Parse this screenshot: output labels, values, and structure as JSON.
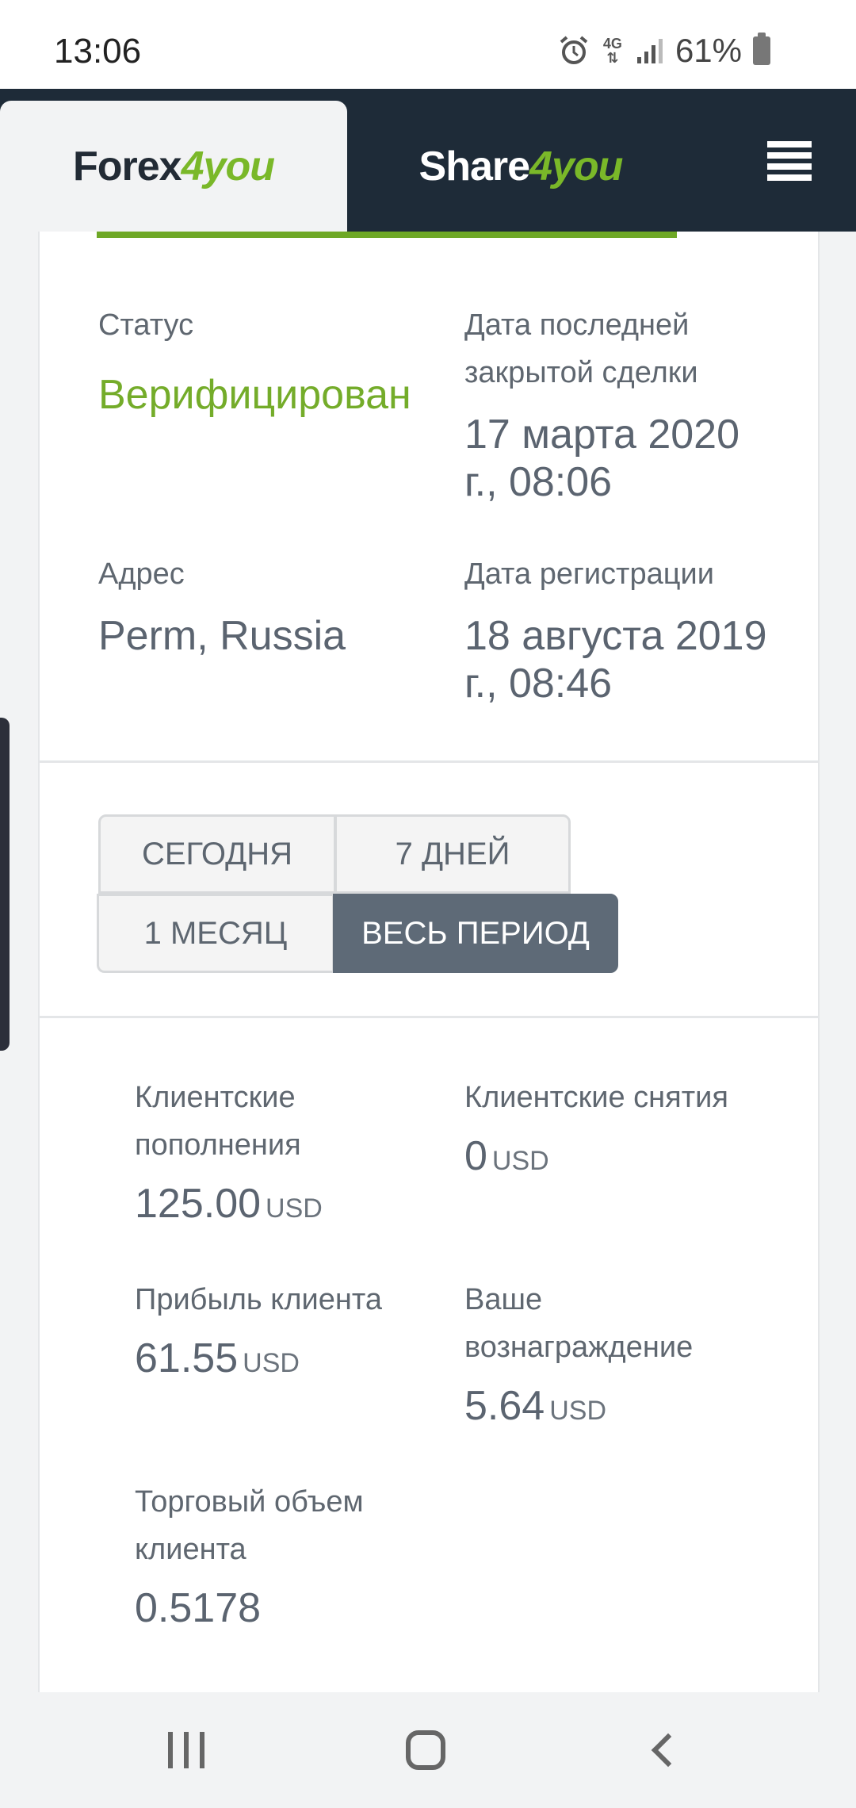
{
  "status_bar": {
    "time": "13:06",
    "network": "4G",
    "battery": "61%"
  },
  "header": {
    "tab1": {
      "part1": "Forex",
      "part2": "4",
      "part3": "you"
    },
    "tab2": {
      "part1": "Share",
      "part2": "4",
      "part3": "you"
    }
  },
  "info": {
    "status_label": "Статус",
    "status_value": "Верифицирован",
    "last_deal_label": "Дата последней закрытой сделки",
    "last_deal_value": "17 марта 2020 г., 08:06",
    "address_label": "Адрес",
    "address_value": "Perm, Russia",
    "reg_label": "Дата регистрации",
    "reg_value": "18 августа 2019 г., 08:46"
  },
  "periods": {
    "today": "СЕГОДНЯ",
    "week": "7 ДНЕЙ",
    "month": "1 МЕСЯЦ",
    "all": "ВЕСЬ ПЕРИОД",
    "selected": "ВЕСЬ ПЕРИОД"
  },
  "stats": {
    "deposits_label": "Клиентские пополнения",
    "deposits_value": "125.00",
    "withdrawals_label": "Клиентские снятия",
    "withdrawals_value": "0",
    "profit_label": "Прибыль клиента",
    "profit_value": "61.55",
    "reward_label": "Ваше вознаграждение",
    "reward_value": "5.64",
    "volume_label": "Торговый объем клиента",
    "volume_value": "0.5178",
    "currency": "USD"
  },
  "colors": {
    "header_bg": "#1e2b38",
    "accent_green": "#74ac2a",
    "active_button": "#5e6a77"
  }
}
